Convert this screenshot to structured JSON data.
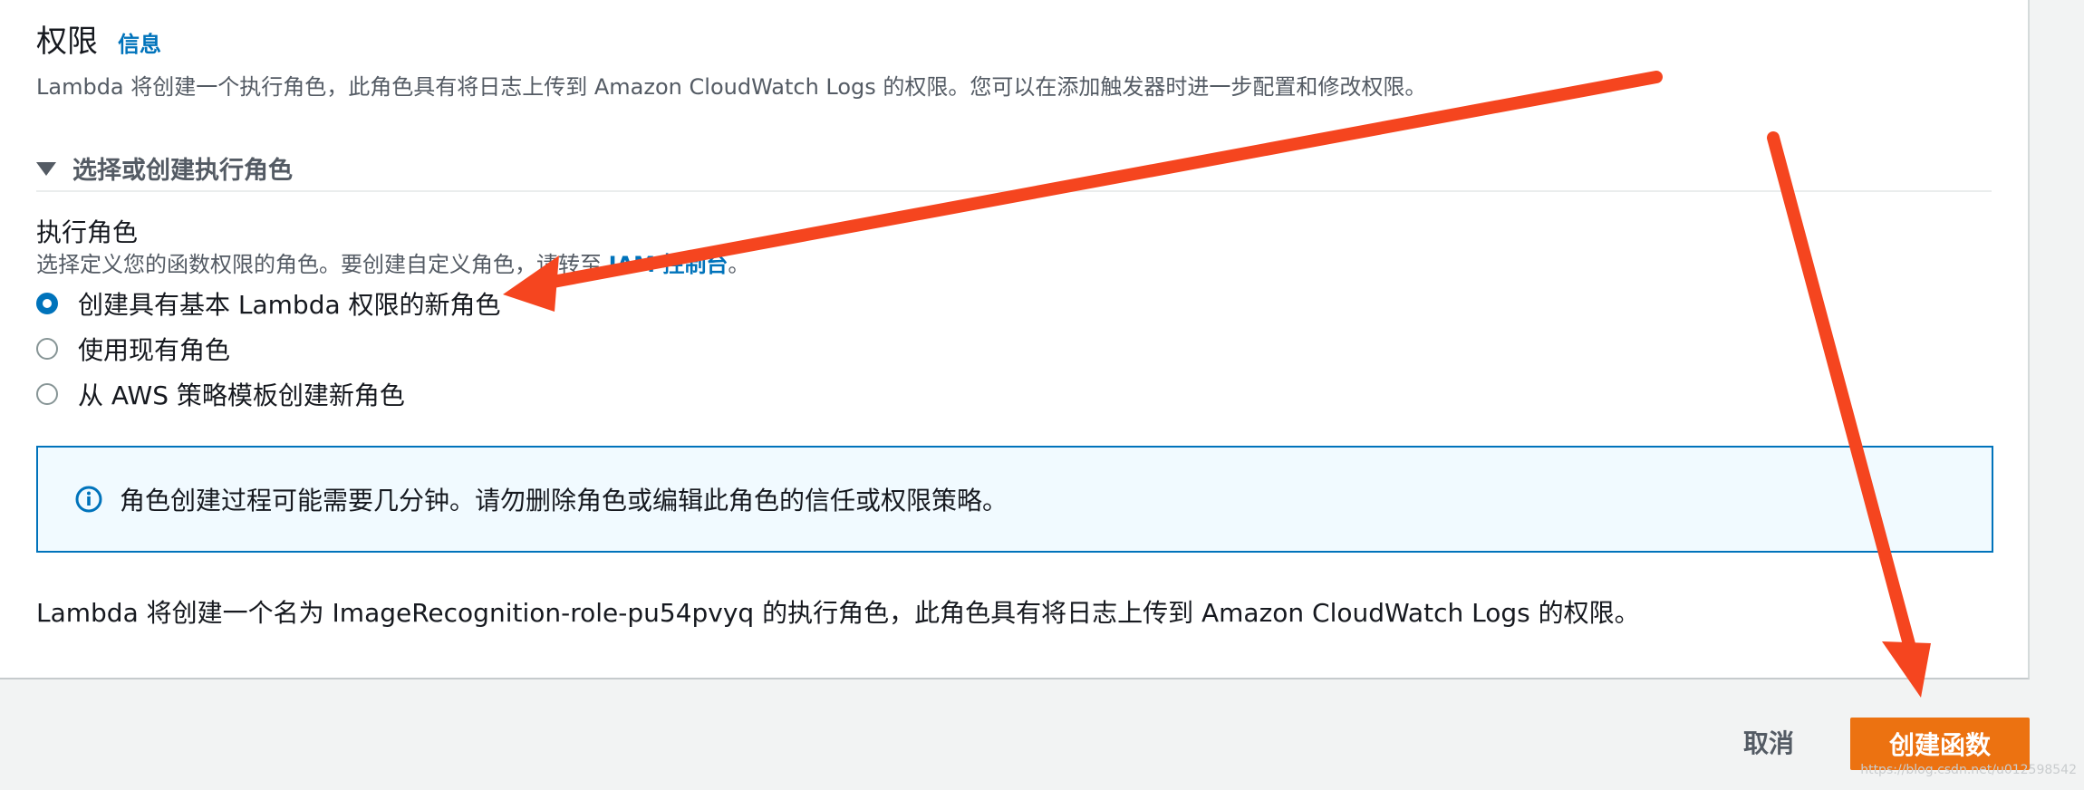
{
  "permissions": {
    "title": "权限",
    "info_link": "信息",
    "description": "Lambda 将创建一个执行角色，此角色具有将日志上传到 Amazon CloudWatch Logs 的权限。您可以在添加触发器时进一步配置和修改权限。"
  },
  "execution_role": {
    "expander_label": "选择或创建执行角色",
    "field_label": "执行角色",
    "field_desc_prefix": "选择定义您的函数权限的角色。要创建自定义角色，请转至 ",
    "iam_link": "IAM 控制台",
    "field_desc_suffix": "。",
    "options": [
      {
        "label": "创建具有基本 Lambda 权限的新角色",
        "selected": true
      },
      {
        "label": "使用现有角色",
        "selected": false
      },
      {
        "label": "从 AWS 策略模板创建新角色",
        "selected": false
      }
    ],
    "info_message": "角色创建过程可能需要几分钟。请勿删除角色或编辑此角色的信任或权限策略。",
    "summary": "Lambda 将创建一个名为 ImageRecognition-role-pu54pvyq 的执行角色，此角色具有将日志上传到 Amazon CloudWatch Logs 的权限。"
  },
  "footer": {
    "cancel_label": "取消",
    "create_label": "创建函数"
  },
  "watermark": "https://blog.csdn.net/u012598542",
  "colors": {
    "link": "#0073bb",
    "primary_button": "#ec7211",
    "annotation_arrow": "#f5451f"
  },
  "icons": {
    "info": "info-circle-icon",
    "expander": "caret-down-icon"
  }
}
